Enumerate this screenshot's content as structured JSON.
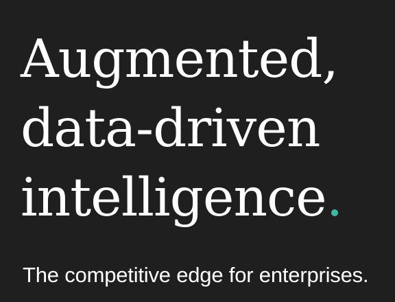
{
  "hero": {
    "headline": {
      "line1": "Augmented,",
      "line2": "data-driven",
      "line3": "intelligence",
      "accent_mark": "."
    },
    "subtitle": "The competitive edge for enterprises.",
    "colors": {
      "background": "#1f1f1f",
      "text": "#ffffff",
      "accent": "#3fb9a3"
    }
  }
}
